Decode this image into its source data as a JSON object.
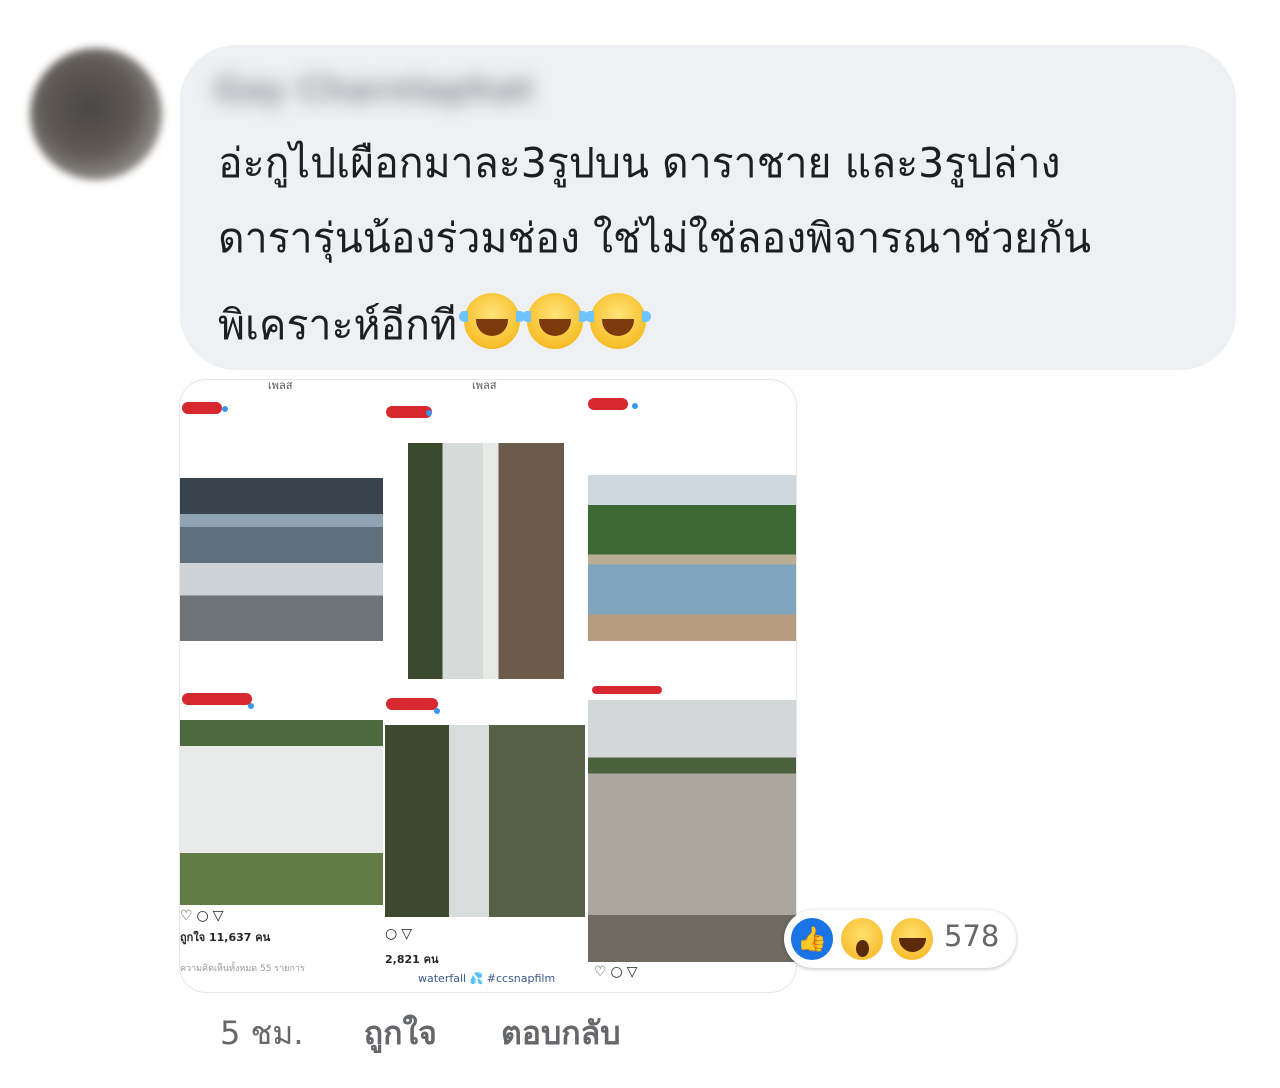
{
  "comment": {
    "author_name": "Gay Charnlaphat",
    "lines": [
      "อ่ะกูไปเผือกมาละ3รูปบน ดาราชาย และ3รูปล่าง",
      "ดารารุ่นน้องร่วมช่อง ใช่ไม่ใช่ลองพิจารณาช่วยกัน",
      "พิเคราะห์อีกที"
    ],
    "emoji": [
      "face-with-tears-of-joy",
      "face-with-tears-of-joy",
      "face-with-tears-of-joy"
    ]
  },
  "attachment": {
    "screens": {
      "top_titles": [
        "เพลส",
        "เพลส"
      ],
      "likes_left": "ถูกใจ 11,637 คน",
      "caption_left": "ความคิดเห็นทั้งหมด 55 รายการ",
      "likes_middle": "2,821 คน",
      "caption_middle": "waterfall 💦 #ccsnapfilm"
    }
  },
  "reactions": {
    "types": [
      "like-icon",
      "wow-icon",
      "haha-icon"
    ],
    "count": "578"
  },
  "actions": {
    "time": "5 ชม.",
    "like": "ถูกใจ",
    "reply": "ตอบกลับ"
  },
  "colors": {
    "bubble": "#eef0f3",
    "secondary_text": "#65676b",
    "like_blue": "#1b74e4"
  }
}
